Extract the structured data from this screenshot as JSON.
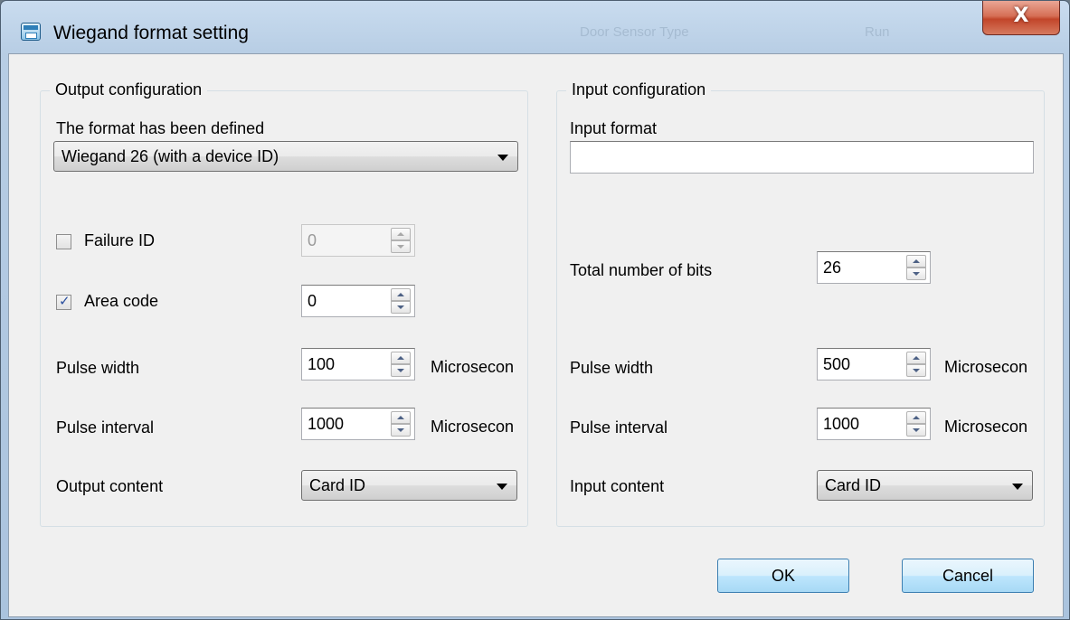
{
  "window": {
    "title": "Wiegand format setting",
    "close_glyph": "X",
    "background_hint_1": "Door Sensor Type",
    "background_hint_2": "Run"
  },
  "output": {
    "group_title": "Output configuration",
    "format_label": "The format has been defined",
    "format_value": "Wiegand 26 (with a device ID)",
    "failure_id": {
      "label": "Failure ID",
      "checked": false,
      "value": "0",
      "enabled": false
    },
    "area_code": {
      "label": "Area code",
      "checked": true,
      "value": "0"
    },
    "pulse_width": {
      "label": "Pulse width",
      "value": "100",
      "unit": "Microsecon"
    },
    "pulse_interval": {
      "label": "Pulse interval",
      "value": "1000",
      "unit": "Microsecon"
    },
    "content": {
      "label": "Output content",
      "value": "Card ID"
    }
  },
  "input": {
    "group_title": "Input configuration",
    "format_label": "Input format",
    "format_value": "",
    "total_bits": {
      "label": "Total number of bits",
      "value": "26"
    },
    "pulse_width": {
      "label": "Pulse width",
      "value": "500",
      "unit": "Microsecon"
    },
    "pulse_interval": {
      "label": "Pulse interval",
      "value": "1000",
      "unit": "Microsecon"
    },
    "content": {
      "label": "Input content",
      "value": "Card ID"
    }
  },
  "buttons": {
    "ok": "OK",
    "cancel": "Cancel"
  },
  "colors": {
    "title_gradient": "#b7cde4",
    "close_red": "#c2452a",
    "client_bg": "#f0f0f0",
    "default_button": "#bee6fd"
  },
  "icons": {
    "app": "app-window-icon",
    "checkmark": "✓"
  }
}
